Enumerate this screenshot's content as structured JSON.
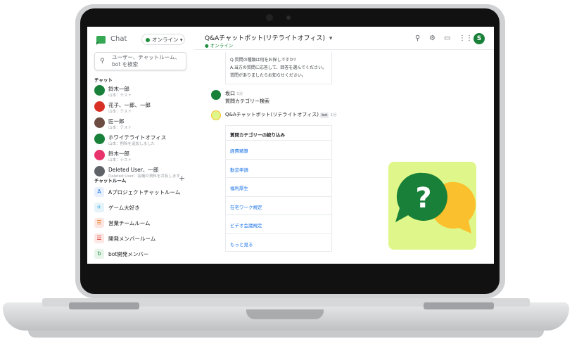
{
  "app": {
    "name": "Chat"
  },
  "status": {
    "label": "オンライン",
    "arrow": "▾",
    "color": "#1e8e3e"
  },
  "search": {
    "placeholder": "ユーザー、チャットルーム、bot を検索"
  },
  "sidebar": {
    "chat_section": "チャット",
    "room_section": "チャットルーム",
    "add": "+",
    "dms": [
      {
        "name": "鈴木一郎",
        "sub": "山本：テスト",
        "avatar_color": "#188038"
      },
      {
        "name": "花子、一郎、一郎",
        "sub": "山本：テスト",
        "avatar_color": "#d93025"
      },
      {
        "name": "匠一郎",
        "sub": "山本：テスト",
        "avatar_color": "#6d4c41"
      },
      {
        "name": "ホワイテライトオフィス",
        "sub": "山本：削除を追加しました",
        "avatar_color": "#188038"
      },
      {
        "name": "鈴木一郎",
        "sub": "山本：テスト",
        "avatar_color": "#e8336d"
      },
      {
        "name": "Deleted User、一郎",
        "sub": "Deleted User：会議の資料を共有します",
        "avatar_color": "#5f6368"
      }
    ],
    "rooms": [
      {
        "letter": "A",
        "name": "Aプロジェクトチャットルーム",
        "bg": "#e8f0fe",
        "fg": "#1a73e8"
      },
      {
        "letter": "✈",
        "name": "ゲーム大好き",
        "bg": "#e6f4fa",
        "fg": "#4fb3e5"
      },
      {
        "letter": "☰",
        "name": "営業チームルーム",
        "bg": "#fde7e4",
        "fg": "#e8710a"
      },
      {
        "letter": "☰",
        "name": "開発メンバールーム",
        "bg": "#fde7e4",
        "fg": "#d93025"
      },
      {
        "letter": "b",
        "name": "bot開発メンバー",
        "bg": "#e6f4ea",
        "fg": "#1e8e3e"
      }
    ]
  },
  "header": {
    "title": "Q&Aチャットボット(リテライトオフィス)",
    "dropdown": "▾",
    "status": "● オンライン",
    "icons": [
      "search-icon",
      "settings-icon",
      "feedback-icon",
      "apps-icon"
    ],
    "avatar_letter": "S"
  },
  "messages": {
    "intro_line1": "Q.質問の種類は何をお探しですか?",
    "intro_line2": "A.当方の質問に応答して、回答を選んでください。質問がありましたらお知らせください。",
    "user_name": "坂口 ",
    "user_time": "1分",
    "user_text": "質問カテゴリー検索",
    "bot_name": "Q&Aチャットボット(リテライトオフィス)",
    "bot_chip": "bot",
    "bot_time": "1分",
    "card_title": "質問カテゴリーの絞り込み",
    "options": [
      "経費精算",
      "勤怠申請",
      "福利厚生",
      "在宅ワーク規定",
      "ビデオ会議規定",
      "もっと見る"
    ]
  },
  "colors": {
    "accent": "#1a73e8",
    "brand": "#188038",
    "icon_bg": "#dff78a",
    "bubble_green": "#188038",
    "bubble_yellow": "#fbc02d"
  }
}
